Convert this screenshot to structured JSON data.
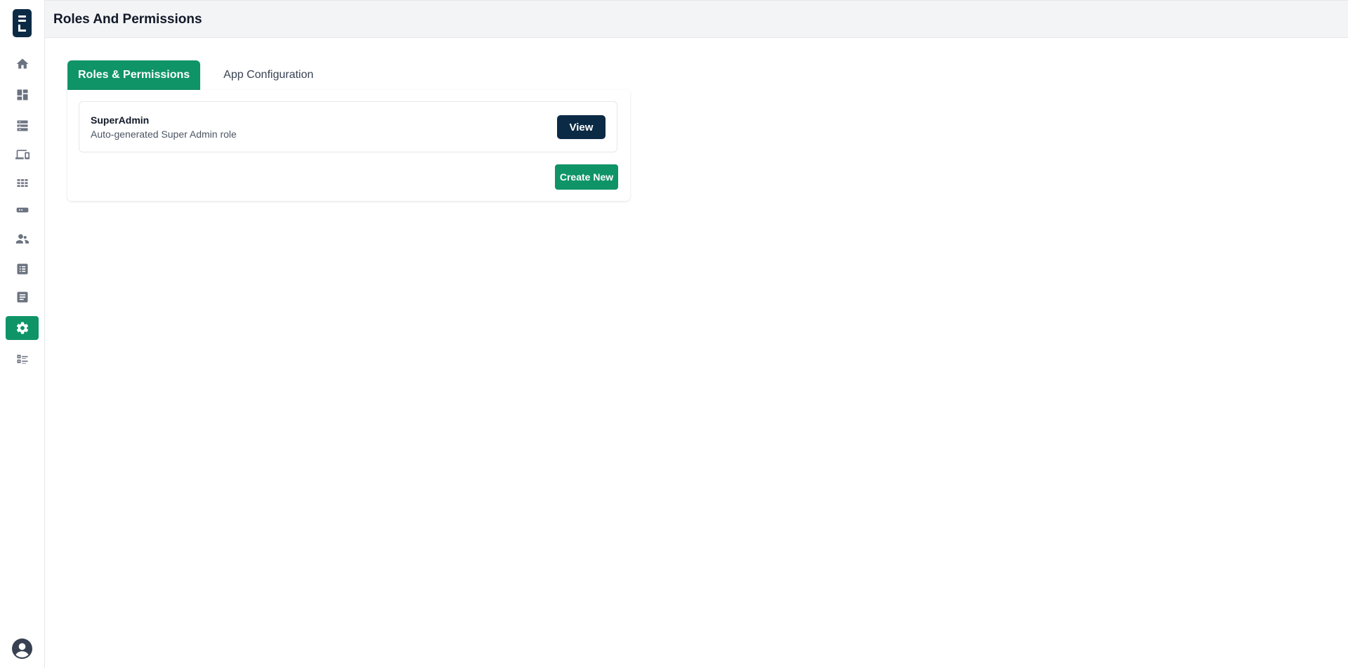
{
  "header": {
    "title": "Roles And Permissions"
  },
  "sidebar": {
    "items": [
      {
        "icon": "home-icon",
        "active": false
      },
      {
        "icon": "dashboard-icon",
        "active": false
      },
      {
        "icon": "storage-icon",
        "active": false
      },
      {
        "icon": "devices-icon",
        "active": false
      },
      {
        "icon": "apps-grid-icon",
        "active": false
      },
      {
        "icon": "router-icon",
        "active": false
      },
      {
        "icon": "users-icon",
        "active": false
      },
      {
        "icon": "list-icon",
        "active": false
      },
      {
        "icon": "document-icon",
        "active": false
      },
      {
        "icon": "gear-icon",
        "active": true
      },
      {
        "icon": "checklist-icon",
        "active": false
      }
    ],
    "accent_color": "#0f9467"
  },
  "tabs": [
    {
      "label": "Roles & Permissions",
      "active": true
    },
    {
      "label": "App Configuration",
      "active": false
    }
  ],
  "roles": [
    {
      "name": "SuperAdmin",
      "description": "Auto-generated Super Admin role",
      "action_label": "View"
    }
  ],
  "actions": {
    "create_label": "Create New"
  },
  "colors": {
    "primary_dark": "#0b2a45",
    "primary_green": "#0f9467"
  }
}
